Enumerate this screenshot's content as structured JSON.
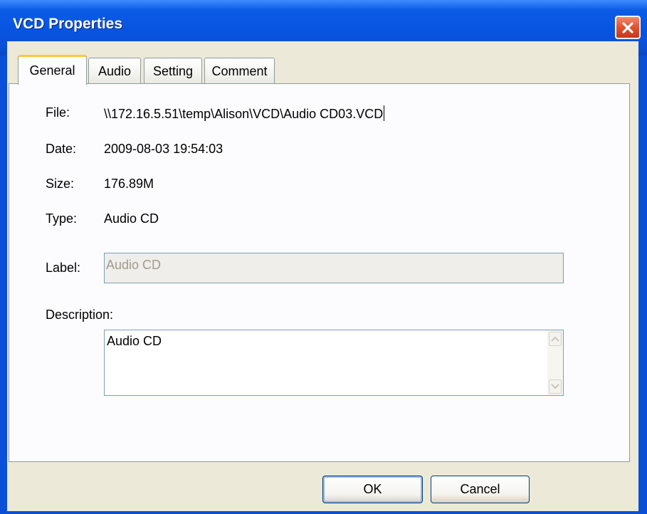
{
  "window": {
    "title": "VCD Properties",
    "close_icon": "close-icon"
  },
  "tabs": [
    {
      "label": "General",
      "active": true
    },
    {
      "label": "Audio",
      "active": false
    },
    {
      "label": "Setting",
      "active": false
    },
    {
      "label": "Comment",
      "active": false
    }
  ],
  "general": {
    "file_label": "File:",
    "file_value": "\\\\172.16.5.51\\temp\\Alison\\VCD\\Audio CD03.VCD",
    "date_label": "Date:",
    "date_value": "2009-08-03 19:54:03",
    "size_label": "Size:",
    "size_value": "176.89M",
    "type_label": "Type:",
    "type_value": "Audio CD",
    "label_label": "Label:",
    "label_value": "Audio CD",
    "description_label": "Description:",
    "description_value": "Audio CD"
  },
  "buttons": {
    "ok": "OK",
    "cancel": "Cancel"
  },
  "colors": {
    "titlebar": "#0a4fd8",
    "dialog_face": "#ece9d8",
    "active_tab_highlight": "#ffc83c",
    "close_button": "#e2502d"
  }
}
